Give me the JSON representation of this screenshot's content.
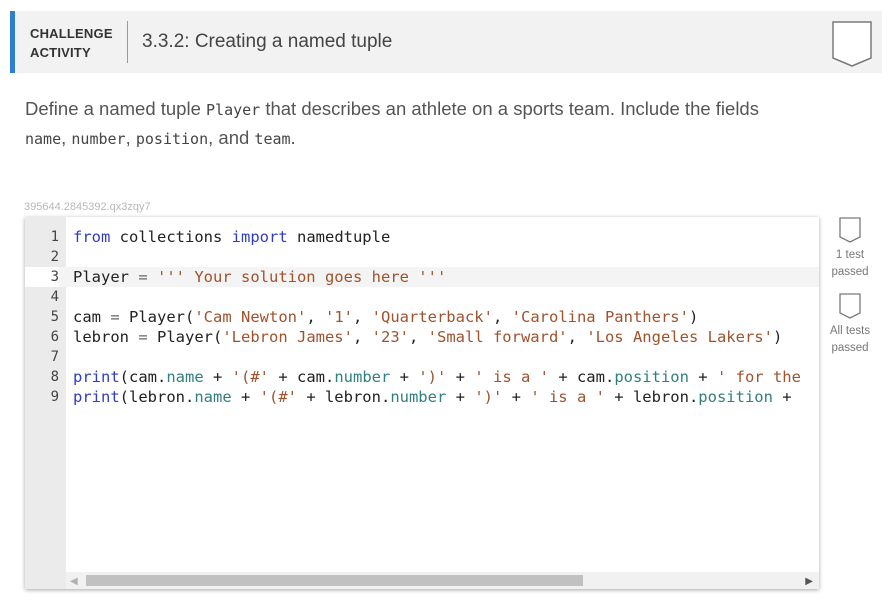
{
  "header": {
    "label_line1": "CHALLENGE",
    "label_line2": "ACTIVITY",
    "title": "3.3.2: Creating a named tuple",
    "accent_color": "#2d7fd6",
    "badge_icon": "badge-outline-icon"
  },
  "instructions": {
    "part1": "Define a named tuple ",
    "code1": "Player",
    "part2": " that describes an athlete on a sports team. Include the fields",
    "code2": "name",
    "sep1": ", ",
    "code3": "number",
    "sep2": ", ",
    "code4": "position",
    "part3": ", and ",
    "code5": "team",
    "part4": "."
  },
  "code_id": "395644.2845392.qx3zqy7",
  "editor": {
    "lines": [
      {
        "n": "1"
      },
      {
        "n": "2"
      },
      {
        "n": "3"
      },
      {
        "n": "4"
      },
      {
        "n": "5"
      },
      {
        "n": "6"
      },
      {
        "n": "7"
      },
      {
        "n": "8"
      },
      {
        "n": "9"
      }
    ],
    "code": {
      "l1_kw1": "from",
      "l1_t1": " collections ",
      "l1_kw2": "import",
      "l1_t2": " namedtuple",
      "l3_t1": "Player ",
      "l3_op": "=",
      "l3_str": " ''' Your solution goes here '''",
      "l5_t1": "cam ",
      "l5_op": "=",
      "l5_t2": " Player(",
      "l5_s1": "'Cam Newton'",
      "l5_c1": ", ",
      "l5_s2": "'1'",
      "l5_c2": ", ",
      "l5_s3": "'Quarterback'",
      "l5_c3": ", ",
      "l5_s4": "'Carolina Panthers'",
      "l5_t3": ")",
      "l6_t1": "lebron ",
      "l6_op": "=",
      "l6_t2": " Player(",
      "l6_s1": "'Lebron James'",
      "l6_c1": ", ",
      "l6_s2": "'23'",
      "l6_c2": ", ",
      "l6_s3": "'Small forward'",
      "l6_c3": ", ",
      "l6_s4": "'Los Angeles Lakers'",
      "l6_t3": ")",
      "l8_kw": "print",
      "l8_t1": "(cam.",
      "l8_a1": "name",
      "l8_t2": " + ",
      "l8_s1": "'(#'",
      "l8_t3": " + cam.",
      "l8_a2": "number",
      "l8_t4": " + ",
      "l8_s2": "')'",
      "l8_t5": " + ",
      "l8_s3": "' is a '",
      "l8_t6": " + cam.",
      "l8_a3": "position",
      "l8_t7": " + ",
      "l8_s4": "' for the",
      "l9_kw": "print",
      "l9_t1": "(lebron.",
      "l9_a1": "name",
      "l9_t2": " + ",
      "l9_s1": "'(#'",
      "l9_t3": " + lebron.",
      "l9_a2": "number",
      "l9_t4": " + ",
      "l9_s2": "')'",
      "l9_t5": " + ",
      "l9_s3": "' is a '",
      "l9_t6": " + lebron.",
      "l9_a3": "position",
      "l9_t7": " +"
    }
  },
  "tests": [
    {
      "line1": "1 test",
      "line2": "passed",
      "icon": "badge-outline-icon"
    },
    {
      "line1": "All tests",
      "line2": "passed",
      "icon": "badge-outline-icon"
    }
  ]
}
